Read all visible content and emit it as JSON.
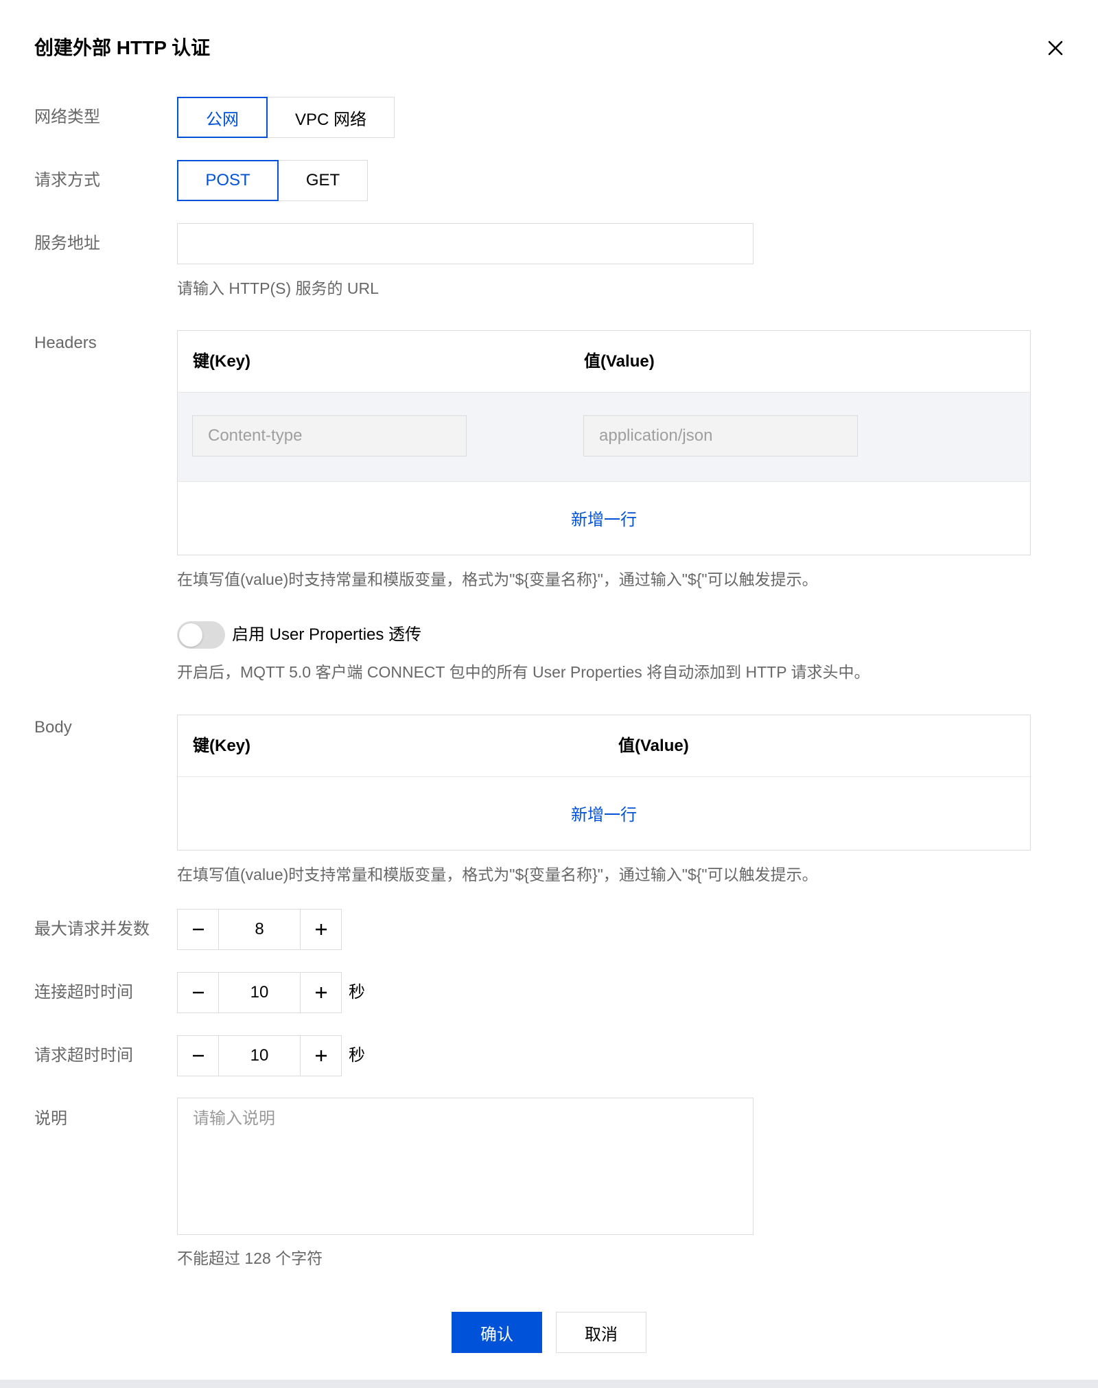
{
  "dialog": {
    "title": "创建外部 HTTP 认证"
  },
  "network": {
    "label": "网络类型",
    "options": [
      "公网",
      "VPC 网络"
    ],
    "selected": "公网"
  },
  "method": {
    "label": "请求方式",
    "options": [
      "POST",
      "GET"
    ],
    "selected": "POST"
  },
  "service": {
    "label": "服务地址",
    "value": "",
    "hint": "请输入 HTTP(S) 服务的 URL"
  },
  "headers": {
    "label": "Headers",
    "col_key": "键(Key)",
    "col_value": "值(Value)",
    "rows": [
      {
        "key": "Content-type",
        "value": "application/json"
      }
    ],
    "add_row": "新增一行",
    "hint": "在填写值(value)时支持常量和模版变量，格式为\"${变量名称}\"，通过输入\"${\"可以触发提示。"
  },
  "user_properties": {
    "label": "启用 User Properties 透传",
    "enabled": false,
    "hint": "开启后，MQTT 5.0 客户端 CONNECT 包中的所有 User Properties 将自动添加到 HTTP 请求头中。"
  },
  "body": {
    "label": "Body",
    "col_key": "键(Key)",
    "col_value": "值(Value)",
    "add_row": "新增一行",
    "hint": "在填写值(value)时支持常量和模版变量，格式为\"${变量名称}\"，通过输入\"${\"可以触发提示。"
  },
  "max_concurrency": {
    "label": "最大请求并发数",
    "value": "8"
  },
  "connect_timeout": {
    "label": "连接超时时间",
    "value": "10",
    "unit": "秒"
  },
  "request_timeout": {
    "label": "请求超时时间",
    "value": "10",
    "unit": "秒"
  },
  "description": {
    "label": "说明",
    "placeholder": "请输入说明",
    "hint": "不能超过 128 个字符"
  },
  "footer": {
    "confirm": "确认",
    "cancel": "取消"
  },
  "colors": {
    "primary": "#0052d9",
    "border": "#dcdcdc"
  }
}
